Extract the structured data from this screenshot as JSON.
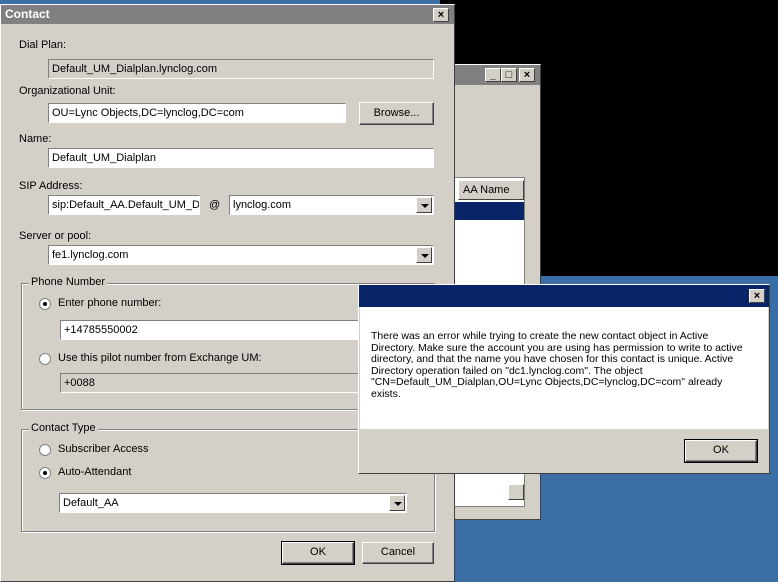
{
  "colors": {
    "desktop": "#3a6ea5",
    "black_window": "#000000",
    "active_title": "#0a246a"
  },
  "contact_dialog": {
    "title": "Contact",
    "dial_plan_label": "Dial Plan:",
    "dial_plan_value": "Default_UM_Dialplan.lynclog.com",
    "ou_label": "Organizational Unit:",
    "ou_value": "OU=Lync Objects,DC=lynclog,DC=com",
    "browse_label": "Browse...",
    "name_label": "Name:",
    "name_value": "Default_UM_Dialplan",
    "sip_label": "SIP Address:",
    "sip_value": "sip:Default_AA.Default_UM_Di",
    "at_sign": "@",
    "sip_domain_value": "lynclog.com",
    "server_label": "Server or pool:",
    "server_value": "fe1.lynclog.com",
    "phone_group_title": "Phone Number",
    "enter_phone_label": "Enter phone number:",
    "phone_value": "+14785550002",
    "pilot_label": "Use this pilot number from Exchange UM:",
    "pilot_value": "+0088",
    "contact_type_title": "Contact Type",
    "subscriber_label": "Subscriber Access",
    "auto_attendant_label": "Auto-Attendant",
    "aa_value": "Default_AA",
    "ok_label": "OK",
    "cancel_label": "Cancel"
  },
  "background_window": {
    "column_header": "AA Name"
  },
  "error_dialog": {
    "message": "There was an error while trying to create the new contact object in Active Directory. Make sure the account you are using has permission to write to active directory, and that the name you have chosen for this contact is unique. Active Directory operation failed on \"dc1.lynclog.com\". The object \"CN=Default_UM_Dialplan,OU=Lync Objects,DC=lynclog,DC=com\" already exists.",
    "ok_label": "OK"
  }
}
